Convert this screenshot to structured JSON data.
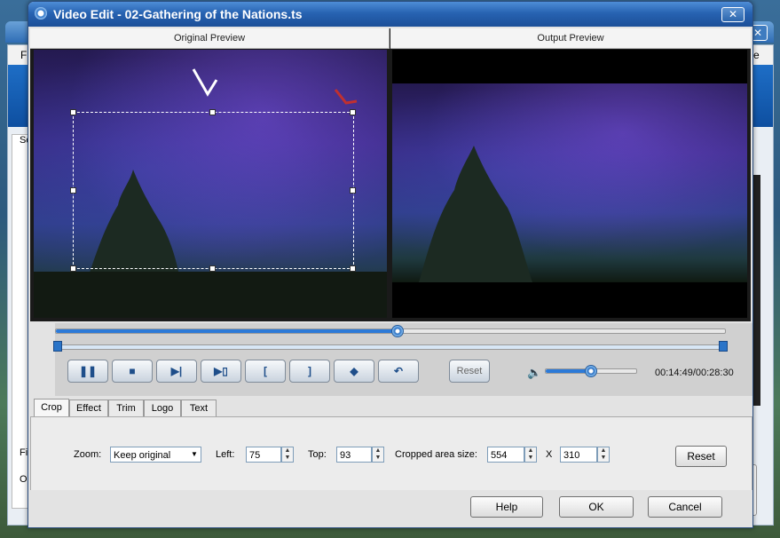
{
  "background_app": {
    "menu_items": [
      "Fi",
      "e"
    ],
    "left_labels": [
      "So",
      "Fi",
      "O"
    ]
  },
  "dialog": {
    "title": "Video Edit - 02-Gathering of the Nations.ts",
    "close_label": "✕"
  },
  "preview": {
    "original_label": "Original Preview",
    "output_label": "Output Preview"
  },
  "transport": {
    "progress": 0.51,
    "volume": 0.5,
    "time": "00:14:49/00:28:30",
    "buttons": [
      {
        "name": "pause-button",
        "label": "❚❚"
      },
      {
        "name": "stop-button",
        "label": "■"
      },
      {
        "name": "next-frame-button",
        "label": "▶|"
      },
      {
        "name": "snapshot-button",
        "label": "▶▯"
      },
      {
        "name": "mark-in-button",
        "label": "["
      },
      {
        "name": "mark-out-button",
        "label": "]"
      },
      {
        "name": "cube-button",
        "label": "◆"
      },
      {
        "name": "undo-button",
        "label": "↶"
      }
    ],
    "reset_label": "Reset"
  },
  "tabs": [
    "Crop",
    "Effect",
    "Trim",
    "Logo",
    "Text"
  ],
  "crop": {
    "zoom_label": "Zoom:",
    "zoom_value": "Keep original",
    "left_label": "Left:",
    "left_value": "75",
    "top_label": "Top:",
    "top_value": "93",
    "area_label": "Cropped area size:",
    "width_value": "554",
    "x_label": "X",
    "height_value": "310",
    "reset_label": "Reset"
  },
  "footer": {
    "help_label": "Help",
    "ok_label": "OK",
    "cancel_label": "Cancel"
  }
}
